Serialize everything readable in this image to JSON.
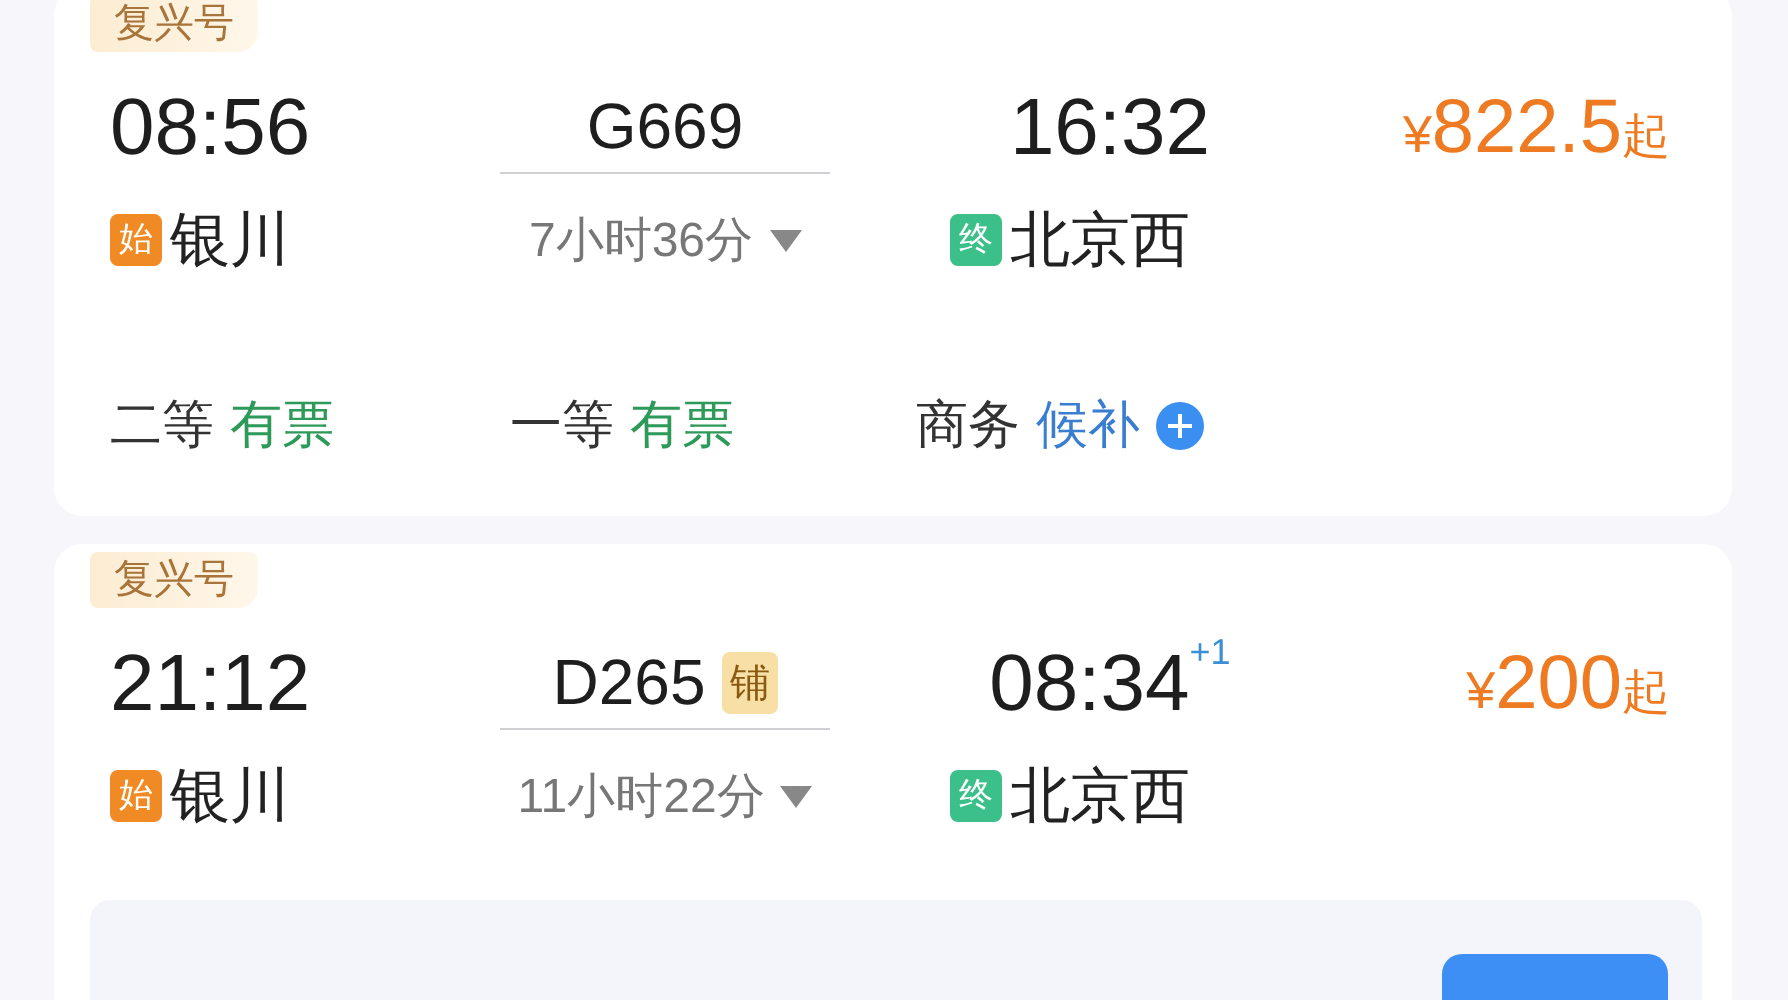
{
  "trains": [
    {
      "type": "复兴号",
      "depart_time": "08:56",
      "train_no": "G669",
      "arrive_time": "16:32",
      "duration": "7小时36分",
      "from_tag": "始",
      "from": "银川",
      "to_tag": "终",
      "to": "北京西",
      "currency": "¥",
      "price": "822.5",
      "price_suffix": "起",
      "expanded": false,
      "seats": [
        {
          "class": "二等",
          "status": "有票",
          "kind": "available"
        },
        {
          "class": "一等",
          "status": "有票",
          "kind": "available"
        },
        {
          "class": "商务",
          "status": "候补",
          "kind": "waitlist"
        }
      ]
    },
    {
      "type": "复兴号",
      "depart_time": "21:12",
      "train_no": "D265",
      "berth_tag": "铺",
      "arrive_time": "08:34",
      "day_offset": "+1",
      "duration": "11小时22分",
      "from_tag": "始",
      "from": "银川",
      "to_tag": "终",
      "to": "北京西",
      "currency": "¥",
      "price": "200",
      "price_suffix": "起",
      "expanded": true
    }
  ]
}
